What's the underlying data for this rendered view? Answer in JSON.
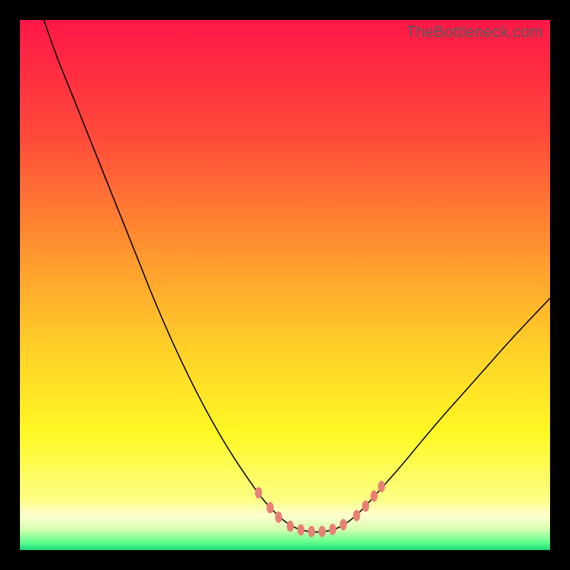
{
  "watermark": "TheBottleneck.com",
  "chart_data": {
    "type": "line",
    "title": "",
    "xlabel": "",
    "ylabel": "",
    "xlim": [
      0,
      100
    ],
    "ylim": [
      0,
      100
    ],
    "grid": false,
    "background_gradient": {
      "orientation": "vertical",
      "stops": [
        {
          "pos": 0.0,
          "color": "#ff1747"
        },
        {
          "pos": 0.22,
          "color": "#ff4a3a"
        },
        {
          "pos": 0.45,
          "color": "#ff9a2e"
        },
        {
          "pos": 0.62,
          "color": "#ffd028"
        },
        {
          "pos": 0.78,
          "color": "#fff824"
        },
        {
          "pos": 0.905,
          "color": "#fdff85"
        },
        {
          "pos": 0.935,
          "color": "#feffd0"
        },
        {
          "pos": 0.96,
          "color": "#d8ffb0"
        },
        {
          "pos": 0.985,
          "color": "#63ff8f"
        },
        {
          "pos": 1.0,
          "color": "#1cd97a"
        }
      ]
    },
    "series": [
      {
        "name": "bottleneck-curve",
        "color": "#000000",
        "width": 1.6,
        "points": [
          {
            "x": 4.5,
            "y": 100.0
          },
          {
            "x": 7.0,
            "y": 93.0
          },
          {
            "x": 10.0,
            "y": 85.5
          },
          {
            "x": 13.0,
            "y": 78.0
          },
          {
            "x": 16.0,
            "y": 70.5
          },
          {
            "x": 19.0,
            "y": 63.0
          },
          {
            "x": 22.0,
            "y": 55.5
          },
          {
            "x": 25.0,
            "y": 48.0
          },
          {
            "x": 28.0,
            "y": 41.0
          },
          {
            "x": 31.0,
            "y": 34.5
          },
          {
            "x": 34.0,
            "y": 28.5
          },
          {
            "x": 37.0,
            "y": 23.0
          },
          {
            "x": 40.0,
            "y": 18.0
          },
          {
            "x": 43.0,
            "y": 13.5
          },
          {
            "x": 45.5,
            "y": 10.0
          },
          {
            "x": 48.0,
            "y": 7.2
          },
          {
            "x": 50.0,
            "y": 5.4
          },
          {
            "x": 52.0,
            "y": 4.2
          },
          {
            "x": 54.0,
            "y": 3.6
          },
          {
            "x": 56.0,
            "y": 3.4
          },
          {
            "x": 58.0,
            "y": 3.6
          },
          {
            "x": 60.0,
            "y": 4.2
          },
          {
            "x": 62.0,
            "y": 5.4
          },
          {
            "x": 64.0,
            "y": 7.1
          },
          {
            "x": 66.0,
            "y": 9.2
          },
          {
            "x": 68.5,
            "y": 12.0
          },
          {
            "x": 72.0,
            "y": 16.0
          },
          {
            "x": 76.0,
            "y": 20.8
          },
          {
            "x": 80.0,
            "y": 25.5
          },
          {
            "x": 84.0,
            "y": 30.0
          },
          {
            "x": 88.0,
            "y": 34.5
          },
          {
            "x": 92.0,
            "y": 39.0
          },
          {
            "x": 96.0,
            "y": 43.3
          },
          {
            "x": 100.0,
            "y": 47.5
          }
        ]
      }
    ],
    "markers": {
      "name": "highlight-dots",
      "color": "#e98076",
      "rx": 5,
      "ry": 8,
      "points": [
        {
          "x": 45.0,
          "y": 10.8
        },
        {
          "x": 47.2,
          "y": 8.0
        },
        {
          "x": 48.8,
          "y": 6.2
        },
        {
          "x": 51.0,
          "y": 4.5
        },
        {
          "x": 53.0,
          "y": 3.8
        },
        {
          "x": 55.0,
          "y": 3.5
        },
        {
          "x": 57.0,
          "y": 3.5
        },
        {
          "x": 59.0,
          "y": 3.9
        },
        {
          "x": 61.0,
          "y": 4.8
        },
        {
          "x": 63.5,
          "y": 6.5
        },
        {
          "x": 65.2,
          "y": 8.3
        },
        {
          "x": 66.8,
          "y": 10.2
        },
        {
          "x": 68.2,
          "y": 12.0
        }
      ]
    }
  }
}
